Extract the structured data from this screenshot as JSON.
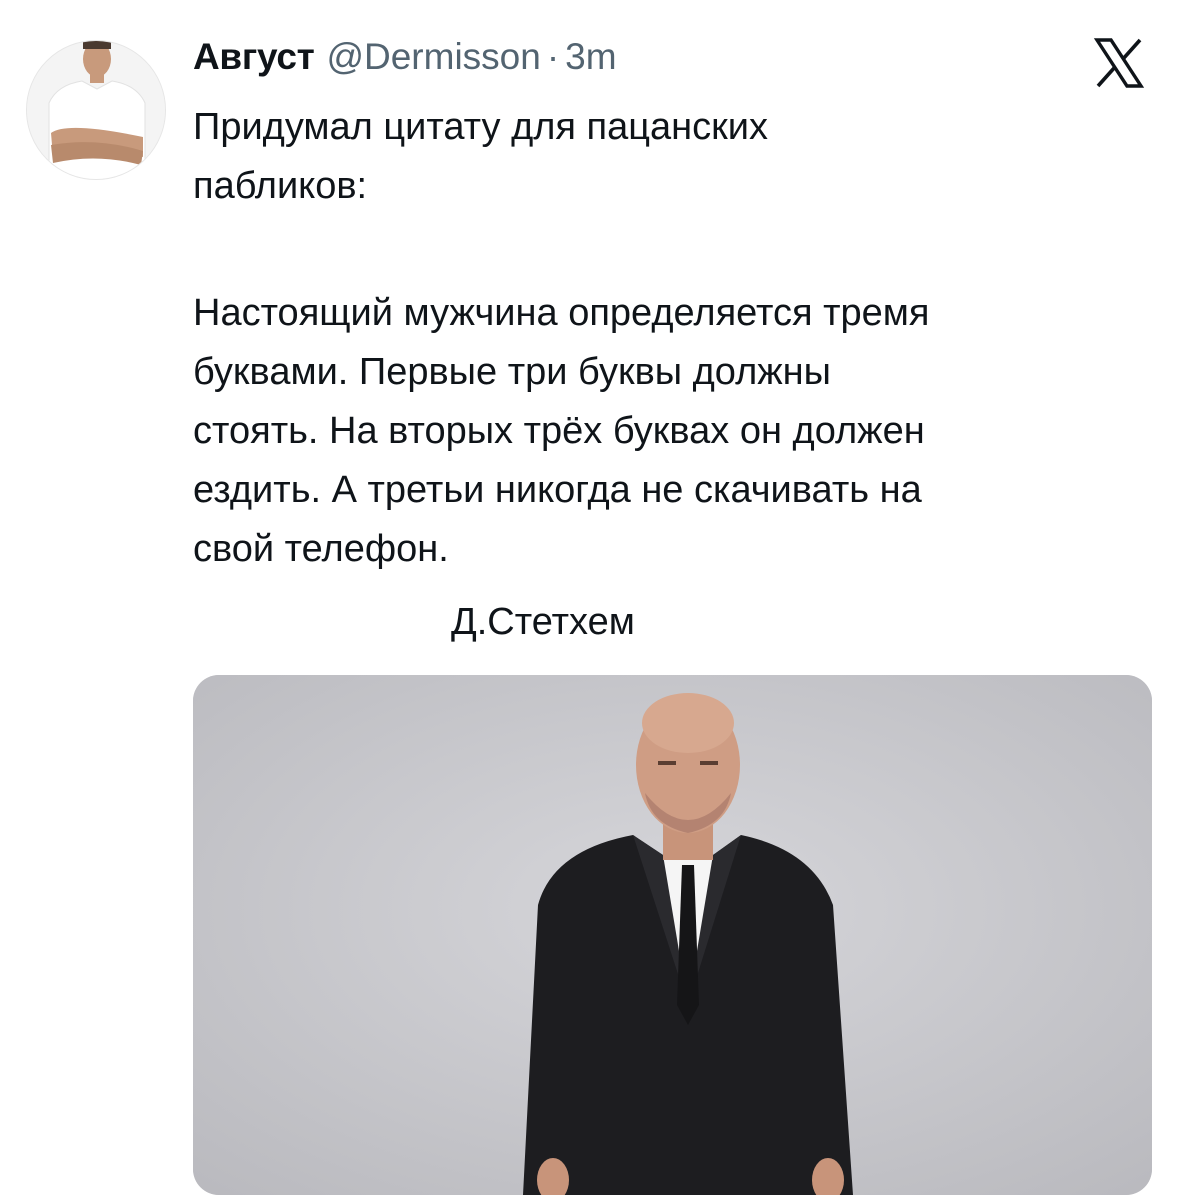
{
  "tweet": {
    "author_name": "Август",
    "author_handle": "@Dermisson",
    "separator": "·",
    "time": "3m",
    "text_intro": "Придумал цитату для пацанских\nпабликов:",
    "text_quote": "Настоящий мужчина определяется тремя\nбуквами. Первые три буквы должны\nстоять. На вторых трёх буквах он должен\nездить. А третьи никогда не скачивать на\nсвой телефон.",
    "signature": "Д.Стетхем"
  },
  "icons": {
    "platform_logo": "x-logo-icon"
  },
  "colors": {
    "text_primary": "#0f1419",
    "text_secondary": "#536471",
    "background": "#ffffff"
  }
}
